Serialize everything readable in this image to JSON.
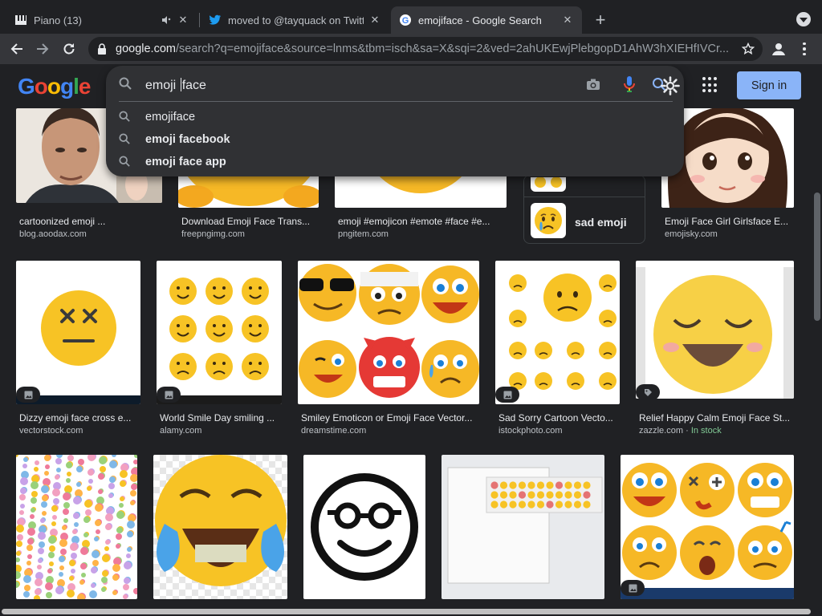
{
  "tabs": [
    {
      "title": "Piano (13)",
      "favicon": "piano-icon"
    },
    {
      "title": "moved to @tayquack on Twitter",
      "favicon": "twitter-icon"
    },
    {
      "title": "emojiface - Google Search",
      "favicon": "google-icon",
      "active": true
    }
  ],
  "toolbar": {
    "url_host": "google.com",
    "url_rest": "/search?q=emojiface&source=lnms&tbm=isch&sa=X&sqi=2&ved=2ahUKEwjPlebgopD1AhW3hXIEHfIVCr..."
  },
  "search": {
    "logo_letters": [
      "G",
      "o",
      "o",
      "g",
      "l",
      "e"
    ],
    "query_before_caret": "emoji ",
    "query_after_caret": "face",
    "suggestions": [
      {
        "text": "emojiface",
        "bold": false
      },
      {
        "text": "emoji facebook",
        "bold": true
      },
      {
        "text": "emoji face app",
        "bold": true
      }
    ],
    "sign_in": "Sign in"
  },
  "related": {
    "label": "sad emoji"
  },
  "results_row1": [
    {
      "title": "cartoonized emoji ...",
      "source": "blog.aoodax.com"
    },
    {
      "title": "Download Emoji Face Trans...",
      "source": "freepngimg.com"
    },
    {
      "title": "emoji #emojicon #emote #face #e...",
      "source": "pngitem.com"
    },
    {
      "title": "Emoji Face Girl Girlsface E...",
      "source": "emojisky.com"
    }
  ],
  "results_row2": [
    {
      "title": "Dizzy emoji face cross e...",
      "source": "vectorstock.com"
    },
    {
      "title": "World Smile Day smiling ...",
      "source": "alamy.com"
    },
    {
      "title": "Smiley Emoticon or Emoji Face Vector...",
      "source": "dreamstime.com"
    },
    {
      "title": "Sad Sorry Cartoon Vecto...",
      "source": "istockphoto.com"
    },
    {
      "title": "Relief Happy Calm Emoji Face St...",
      "source": "zazzle.com",
      "stock": "In stock"
    }
  ],
  "colors": {
    "accent": "#8ab4f8",
    "background": "#202124",
    "emoji_yellow": "#f7c325"
  }
}
